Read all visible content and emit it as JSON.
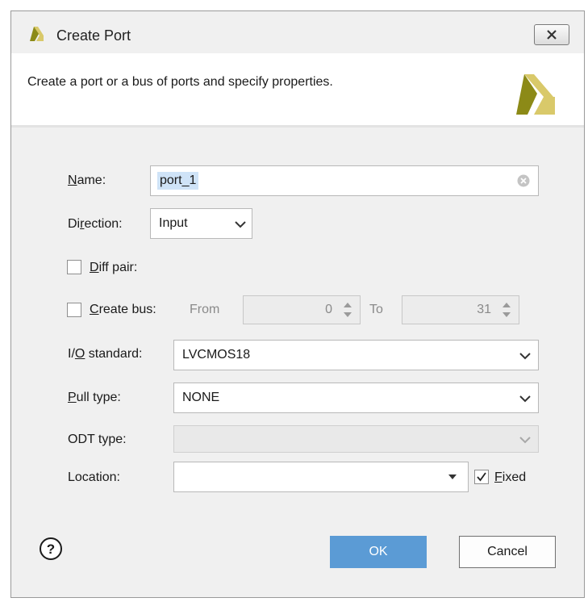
{
  "window": {
    "title": "Create Port",
    "close_label": "Close"
  },
  "header": {
    "description": "Create a port or a bus of ports and specify properties."
  },
  "form": {
    "name": {
      "label_pre": "",
      "label_u": "N",
      "label_post": "ame:",
      "value": "port_1"
    },
    "direction": {
      "label_pre": "Di",
      "label_u": "r",
      "label_post": "ection:",
      "value": "Input"
    },
    "diff_pair": {
      "label_pre": "",
      "label_u": "D",
      "label_post": "iff pair:",
      "checked": false
    },
    "create_bus": {
      "label_pre": "",
      "label_u": "C",
      "label_post": "reate bus:",
      "checked": false,
      "from_label": "From",
      "from_value": "0",
      "to_label": "To",
      "to_value": "31"
    },
    "io_standard": {
      "label_pre": "I/",
      "label_u": "O",
      "label_post": " standard:",
      "value": "LVCMOS18"
    },
    "pull_type": {
      "label_pre": "",
      "label_u": "P",
      "label_post": "ull type:",
      "value": "NONE"
    },
    "odt_type": {
      "label": "ODT type:",
      "value": ""
    },
    "location": {
      "label": "Location:",
      "value": "",
      "fixed_checked": true,
      "fixed_u": "F",
      "fixed_post": "ixed"
    }
  },
  "buttons": {
    "ok": "OK",
    "cancel": "Cancel"
  },
  "colors": {
    "accent": "#5b9bd5",
    "dialog_bg": "#f0f0f0",
    "logo_yellow": "#d9c96a",
    "logo_olive": "#8c8a17"
  },
  "icons": [
    "xilinx-logo-icon",
    "close-icon",
    "clear-icon",
    "chevron-down-icon",
    "spinner-arrows-icon",
    "checkmark-icon",
    "help-icon"
  ]
}
